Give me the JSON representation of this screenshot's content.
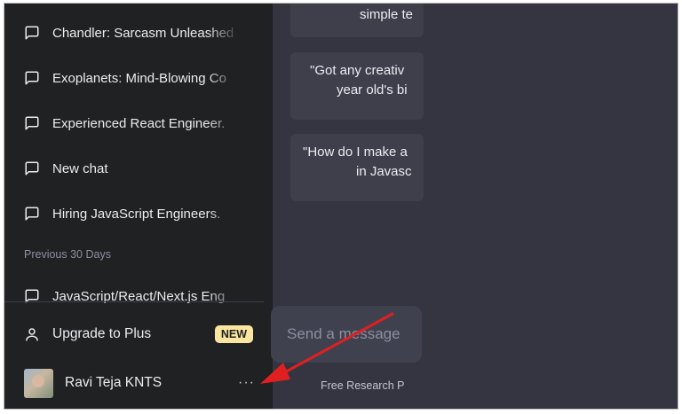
{
  "sidebar": {
    "chats_recent": [
      {
        "label": "Chandler: Sarcasm Unleashed"
      },
      {
        "label": "Exoplanets: Mind-Blowing Co"
      },
      {
        "label": "Experienced React Engineer."
      },
      {
        "label": "New chat"
      },
      {
        "label": "Hiring JavaScript Engineers."
      }
    ],
    "section_previous": "Previous 30 Days",
    "chats_previous": [
      {
        "label": "JavaScript/React/Next.js Eng"
      }
    ],
    "upgrade": {
      "label": "Upgrade to Plus",
      "badge": "NEW"
    },
    "user": {
      "name": "Ravi Teja KNTS",
      "more": "···"
    }
  },
  "main": {
    "examples": [
      {
        "line1": "simple te",
        "line2": ""
      },
      {
        "line1": "\"Got any creativ",
        "line2": "year old's bi"
      },
      {
        "line1": "\"How do I make a",
        "line2": "in Javasc"
      }
    ],
    "composer": {
      "placeholder": "Send a message"
    },
    "footer": "Free Research P"
  },
  "colors": {
    "sidebar_bg": "#202123",
    "main_bg": "#343541",
    "card_bg": "#3e3f4b",
    "badge_bg": "#fae69e",
    "annotation_arrow": "#e02020"
  }
}
